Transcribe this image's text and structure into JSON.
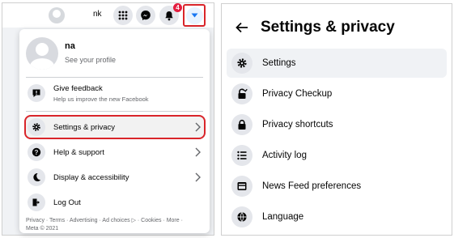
{
  "topbar": {
    "user_name": "nk",
    "notification_count": "4",
    "icons": [
      "avatar",
      "apps-grid-icon",
      "messenger-icon",
      "bell-icon",
      "caret-down-icon"
    ]
  },
  "menu": {
    "profile": {
      "name": "na",
      "subtitle": "See your profile"
    },
    "feedback": {
      "title": "Give feedback",
      "subtitle": "Help us improve the new Facebook"
    },
    "items": [
      {
        "label": "Settings & privacy",
        "icon": "gear-icon",
        "highlighted": true
      },
      {
        "label": "Help & support",
        "icon": "question-icon"
      },
      {
        "label": "Display & accessibility",
        "icon": "moon-icon"
      },
      {
        "label": "Log Out",
        "icon": "logout-icon"
      }
    ],
    "footer_line1": "Privacy · Terms · Advertising · Ad choices ▷ · Cookies · More ·",
    "footer_line2": "Meta © 2021"
  },
  "settings": {
    "title": "Settings & privacy",
    "items": [
      {
        "label": "Settings",
        "icon": "gear-icon",
        "selected": true
      },
      {
        "label": "Privacy Checkup",
        "icon": "lock-check-icon"
      },
      {
        "label": "Privacy shortcuts",
        "icon": "lock-icon"
      },
      {
        "label": "Activity log",
        "icon": "list-icon"
      },
      {
        "label": "News Feed preferences",
        "icon": "feed-icon"
      },
      {
        "label": "Language",
        "icon": "globe-icon"
      }
    ]
  },
  "colors": {
    "highlight": "#d9252a",
    "accent": "#1877f2",
    "badge": "#e41e3f"
  }
}
